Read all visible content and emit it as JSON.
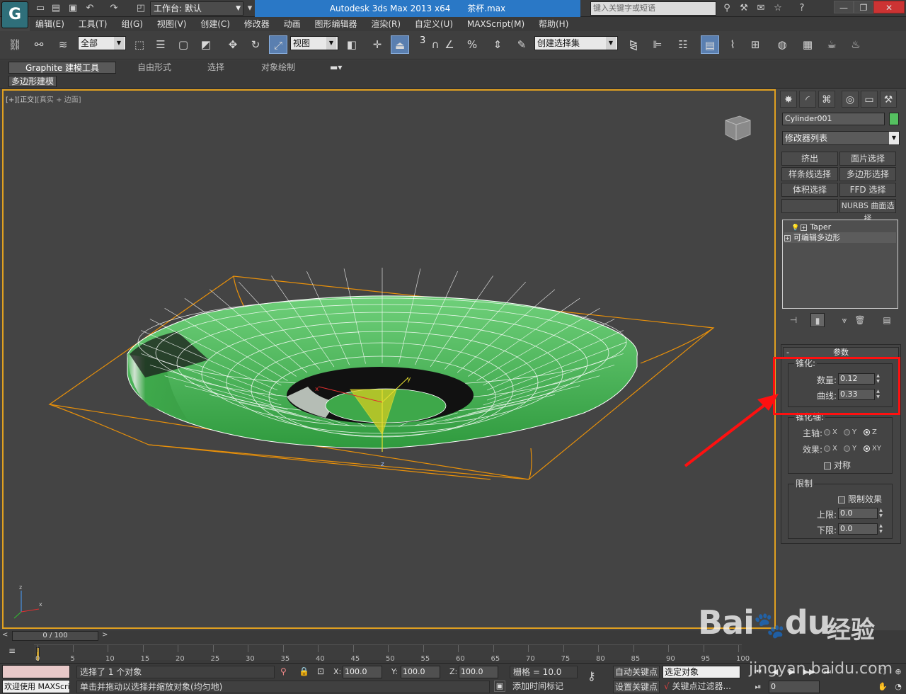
{
  "titlebar": {
    "workspace": "工作台: 默认",
    "app_title": "Autodesk 3ds Max  2013 x64",
    "file_name": "茶杯.max",
    "search_placeholder": "键入关键字或短语"
  },
  "menu": [
    "编辑(E)",
    "工具(T)",
    "组(G)",
    "视图(V)",
    "创建(C)",
    "修改器",
    "动画",
    "图形编辑器",
    "渲染(R)",
    "自定义(U)",
    "MAXScript(M)",
    "帮助(H)"
  ],
  "toolbar": {
    "filter_dd": "全部",
    "ref_coord_dd": "视图",
    "snap_3": "3",
    "named_sel_dd": "创建选择集"
  },
  "ribbon": {
    "tabs": [
      "Graphite 建模工具",
      "自由形式",
      "选择",
      "对象绘制"
    ],
    "sub_tab": "多边形建模"
  },
  "viewport": {
    "label_plus": "[+]",
    "label_view": "[正交]",
    "label_shading": "[真实 + 边面]",
    "axis_x": "x",
    "axis_y": "y",
    "axis_z": "z"
  },
  "command_panel": {
    "object_name": "Cylinder001",
    "object_color": "#55c060",
    "modifier_list": "修改器列表",
    "mod_buttons": [
      "挤出",
      "面片选择",
      "样条线选择",
      "多边形选择",
      "体积选择",
      "FFD 选择",
      "",
      "NURBS 曲面选择"
    ],
    "stack": [
      "Taper",
      "可编辑多边形"
    ],
    "params_title": "参数",
    "taper_group": "锥化:",
    "amount_label": "数量:",
    "amount_value": "0.12",
    "curve_label": "曲线:",
    "curve_value": "0.33",
    "axis_group": "锥化轴:",
    "primary_label": "主轴:",
    "effect_label": "效果:",
    "primary_opts": [
      "X",
      "Y",
      "Z"
    ],
    "effect_opts": [
      "X",
      "Y",
      "XY"
    ],
    "symmetry": "对称",
    "limits_group": "限制",
    "limit_effect": "限制效果",
    "upper_label": "上限:",
    "upper_value": "0.0",
    "lower_label": "下限:",
    "lower_value": "0.0"
  },
  "timeline": {
    "slider": "0 / 100",
    "ticks": [
      "0",
      "5",
      "10",
      "15",
      "20",
      "25",
      "30",
      "35",
      "40",
      "45",
      "50",
      "55",
      "60",
      "65",
      "70",
      "75",
      "80",
      "85",
      "90",
      "95",
      "100"
    ]
  },
  "status": {
    "welcome": "欢迎使用 MAXScri",
    "selected": "选择了 1 个对象",
    "prompt": "单击并拖动以选择并缩放对象(均匀地)",
    "x_label": "X:",
    "x_value": "100.0",
    "y_label": "Y:",
    "y_value": "100.0",
    "z_label": "Z:",
    "z_value": "100.0",
    "grid": "栅格 = 10.0",
    "add_time_tag": "添加时间标记",
    "auto_key": "自动关键点",
    "selected_dd": "选定对象",
    "set_key": "设置关键点",
    "key_filters": "关键点过滤器...",
    "frame": "0"
  },
  "watermark": {
    "brand": "Bai",
    "brand_tail": "du",
    "suffix": "经验",
    "url": "jingyan.baidu.com"
  }
}
